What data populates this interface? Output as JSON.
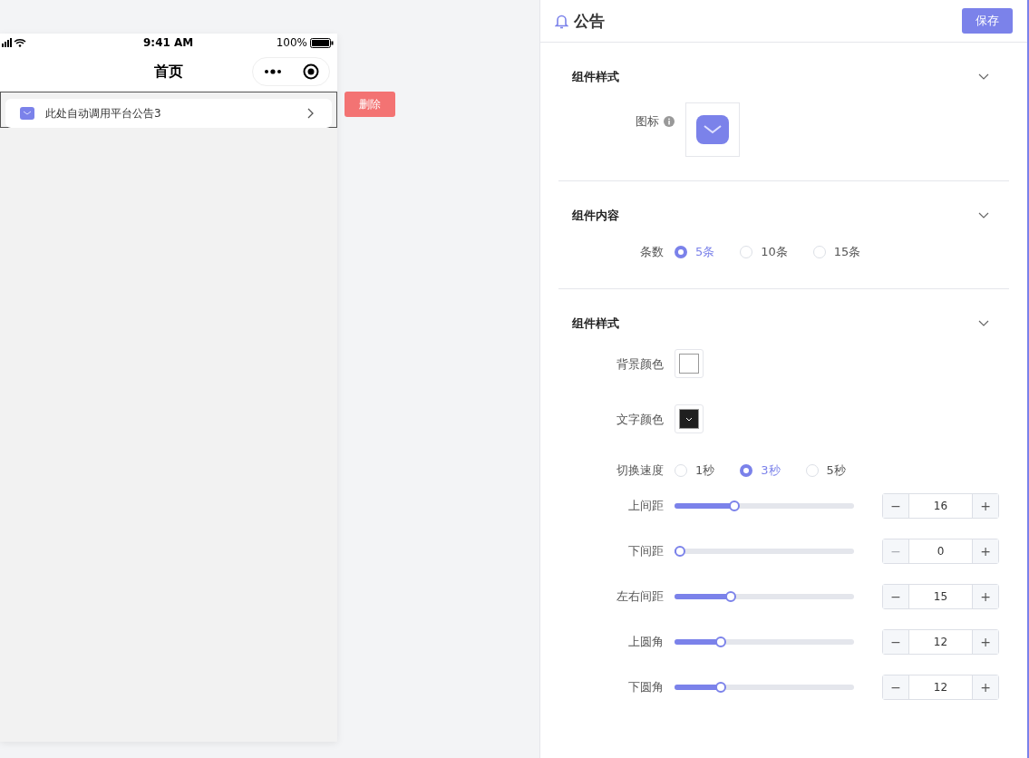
{
  "phone": {
    "time": "9:41 AM",
    "battery": "100%",
    "title": "首页",
    "notice": {
      "text": "此处自动调用平台公告3",
      "selected": true
    },
    "delete_button": "删除"
  },
  "panel": {
    "title": "公告",
    "save_button": "保存",
    "sections": [
      {
        "title": "组件样式",
        "expanded": true,
        "rows": [
          {
            "kind": "icon",
            "label": "图标"
          }
        ]
      },
      {
        "title": "组件内容",
        "expanded": true,
        "rows": [
          {
            "kind": "radio",
            "label": "条数",
            "options": [
              {
                "label": "5条",
                "selected": true
              },
              {
                "label": "10条",
                "selected": false
              },
              {
                "label": "15条",
                "selected": false
              }
            ]
          }
        ]
      },
      {
        "title": "组件样式",
        "expanded": true,
        "rows": [
          {
            "kind": "color",
            "label": "背景颜色",
            "color": "#ffffff"
          },
          {
            "kind": "color",
            "label": "文字颜色",
            "color": "#1f1f1f"
          },
          {
            "kind": "radio",
            "label": "切换速度",
            "options": [
              {
                "label": "1秒",
                "selected": false
              },
              {
                "label": "3秒",
                "selected": true
              },
              {
                "label": "5秒",
                "selected": false
              }
            ]
          },
          {
            "kind": "slider",
            "label": "上间距",
            "level": 0.32,
            "value": "16",
            "minus": "−",
            "plus": "+",
            "minus_disabled": false
          },
          {
            "kind": "slider",
            "label": "下间距",
            "level": 0,
            "value": "0",
            "minus": "−",
            "plus": "+",
            "minus_disabled": true
          },
          {
            "kind": "slider",
            "label": "左右间距",
            "level": 0.3,
            "value": "15",
            "minus": "−",
            "plus": "+",
            "minus_disabled": false
          },
          {
            "kind": "slider",
            "label": "上圆角",
            "level": 0.24,
            "value": "12",
            "minus": "−",
            "plus": "+",
            "minus_disabled": false
          },
          {
            "kind": "slider",
            "label": "下圆角",
            "level": 0.24,
            "value": "12",
            "minus": "−",
            "plus": "+",
            "minus_disabled": false
          }
        ]
      }
    ]
  }
}
